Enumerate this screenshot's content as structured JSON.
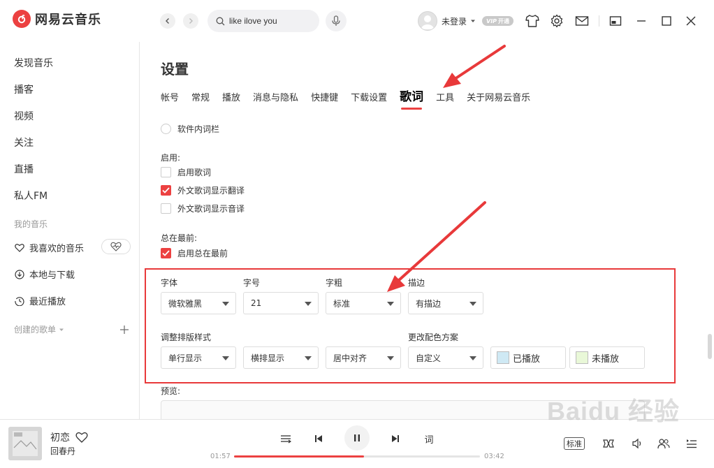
{
  "app": {
    "name": "网易云音乐"
  },
  "search": {
    "value": "like ilove you"
  },
  "user": {
    "name": "未登录",
    "vip_badge": "开通"
  },
  "sidebar": {
    "items": [
      {
        "label": "发现音乐"
      },
      {
        "label": "播客"
      },
      {
        "label": "视频"
      },
      {
        "label": "关注"
      },
      {
        "label": "直播"
      },
      {
        "label": "私人FM"
      }
    ],
    "my_music_header": "我的音乐",
    "my_music": [
      {
        "label": "我喜欢的音乐",
        "icon": "heart-icon"
      },
      {
        "label": "本地与下载",
        "icon": "download-icon"
      },
      {
        "label": "最近播放",
        "icon": "history-icon"
      }
    ],
    "created_playlists_header": "创建的歌单"
  },
  "settings": {
    "title": "设置",
    "tabs": [
      {
        "label": "帐号"
      },
      {
        "label": "常规"
      },
      {
        "label": "播放"
      },
      {
        "label": "消息与隐私"
      },
      {
        "label": "快捷键"
      },
      {
        "label": "下载设置"
      },
      {
        "label": "歌词",
        "active": true
      },
      {
        "label": "工具"
      },
      {
        "label": "关于网易云音乐"
      }
    ],
    "in_app_lyrics_option": "软件内词栏",
    "enable_label": "启用:",
    "enable_lyrics": {
      "label": "启用歌词",
      "checked": false
    },
    "show_translation": {
      "label": "外文歌词显示翻译",
      "checked": true
    },
    "show_romanization": {
      "label": "外文歌词显示音译",
      "checked": false
    },
    "always_on_top_label": "总在最前:",
    "always_on_top": {
      "label": "启用总在最前",
      "checked": true
    },
    "font_label": "字体",
    "font_value": "微软雅黑",
    "size_label": "字号",
    "size_value": "21",
    "weight_label": "字粗",
    "weight_value": "标准",
    "stroke_label": "描边",
    "stroke_value": "有描边",
    "layout_label": "调整排版样式",
    "line_mode_value": "单行显示",
    "orientation_value": "横排显示",
    "align_value": "居中对齐",
    "color_scheme_label": "更改配色方案",
    "color_scheme_value": "自定义",
    "played_color": {
      "label": "已播放",
      "color": "#cfe9f4"
    },
    "unplayed_color": {
      "label": "未播放",
      "color": "#e9f8d8"
    },
    "preview_label": "预览:"
  },
  "player": {
    "song_title": "初恋",
    "artist": "回春丹",
    "current_time": "01:57",
    "total_time": "03:42",
    "progress": 0.527,
    "lyrics_button": "词",
    "quality": "标准"
  },
  "colors": {
    "accent": "#ec4141",
    "annotation": "#e8393a"
  }
}
